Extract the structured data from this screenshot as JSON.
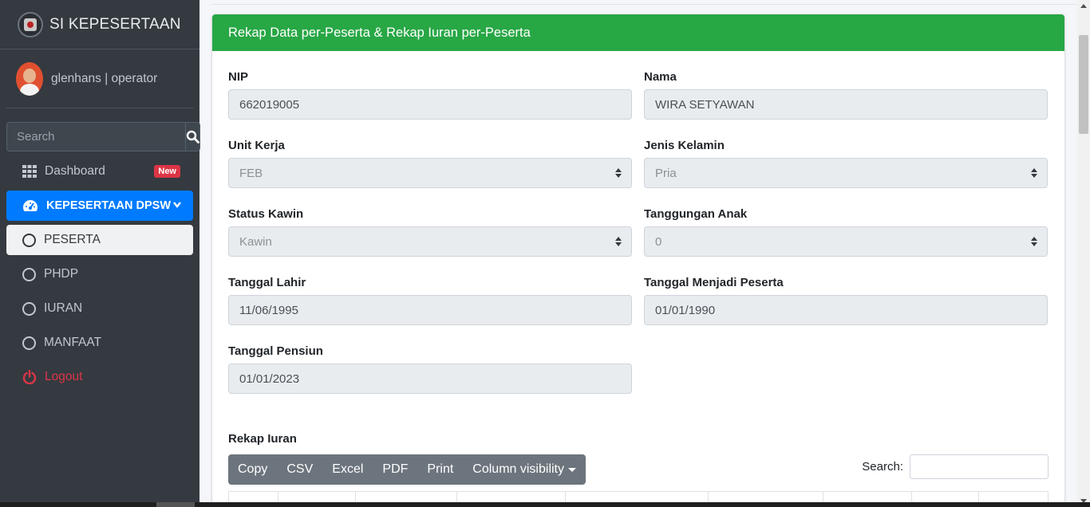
{
  "brand": {
    "title": "SI KEPESERTAAN"
  },
  "user": {
    "name": "glenhans | operator"
  },
  "search": {
    "placeholder": "Search"
  },
  "sidebar": {
    "items": [
      {
        "label": "Dashboard",
        "badge": "New"
      },
      {
        "label": "KEPESERTAAN DPSW"
      },
      {
        "label": "PESERTA"
      },
      {
        "label": "PHDP"
      },
      {
        "label": "IURAN"
      },
      {
        "label": "MANFAAT"
      },
      {
        "label": "Logout"
      }
    ]
  },
  "card": {
    "title": "Rekap Data per-Peserta & Rekap Iuran per-Peserta"
  },
  "form": {
    "nip": {
      "label": "NIP",
      "value": "662019005"
    },
    "nama": {
      "label": "Nama",
      "value": "WIRA SETYAWAN"
    },
    "unit_kerja": {
      "label": "Unit Kerja",
      "value": "FEB"
    },
    "jenis_kelamin": {
      "label": "Jenis Kelamin",
      "value": "Pria"
    },
    "status_kawin": {
      "label": "Status Kawin",
      "value": "Kawin"
    },
    "tanggungan_anak": {
      "label": "Tanggungan Anak",
      "value": "0"
    },
    "tanggal_lahir": {
      "label": "Tanggal Lahir",
      "value": "11/06/1995"
    },
    "tanggal_peserta": {
      "label": "Tanggal Menjadi Peserta",
      "value": "01/01/1990"
    },
    "tanggal_pensiun": {
      "label": "Tanggal Pensiun",
      "value": "01/01/2023"
    }
  },
  "rekap": {
    "title": "Rekap Iuran",
    "buttons": [
      "Copy",
      "CSV",
      "Excel",
      "PDF",
      "Print",
      "Column visibility"
    ],
    "search_label": "Search:"
  },
  "colors": {
    "sidebar": "#343a40",
    "active": "#007bff",
    "header": "#28a745",
    "danger": "#dc3545"
  }
}
